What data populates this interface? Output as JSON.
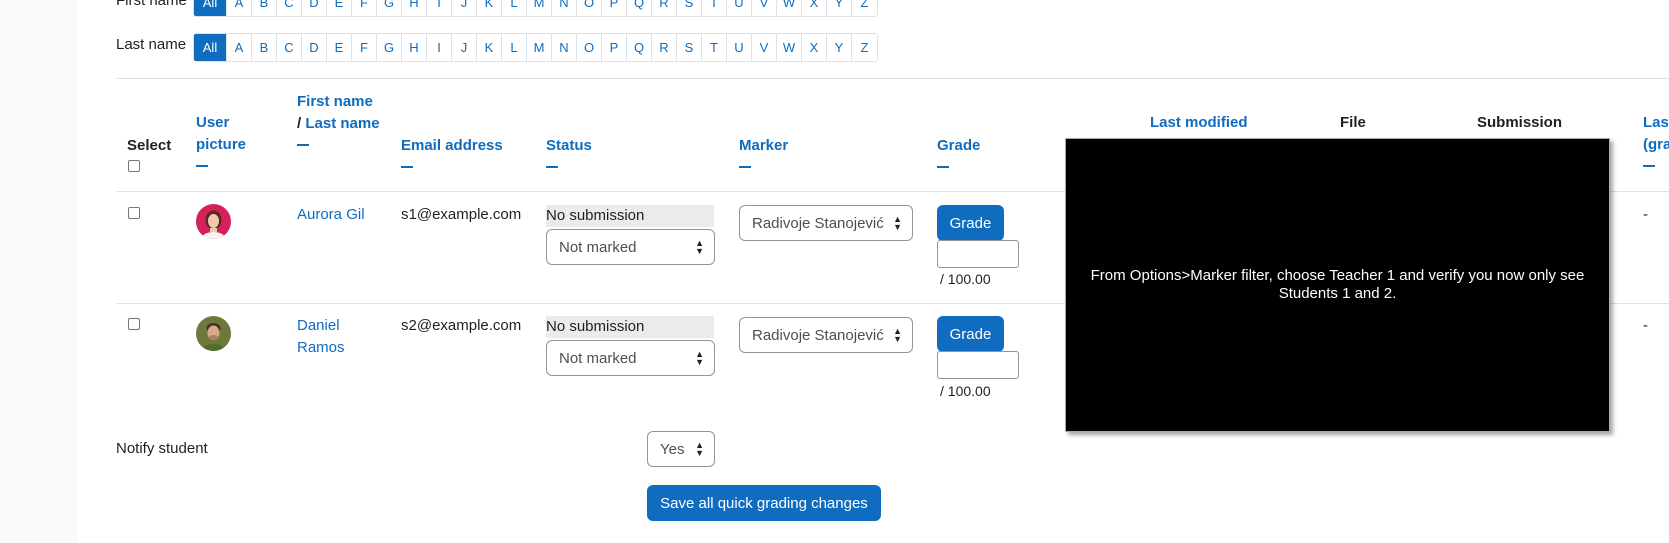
{
  "filters": {
    "first_name_label": "First name",
    "last_name_label": "Last name",
    "letters": [
      "All",
      "A",
      "B",
      "C",
      "D",
      "E",
      "F",
      "G",
      "H",
      "I",
      "J",
      "K",
      "L",
      "M",
      "N",
      "O",
      "P",
      "Q",
      "R",
      "S",
      "T",
      "U",
      "V",
      "W",
      "X",
      "Y",
      "Z"
    ]
  },
  "table": {
    "headers": {
      "select": "Select",
      "user_picture": "User picture",
      "first_name": "First name",
      "slash": "/",
      "last_name": "Last name",
      "email": "Email address",
      "status": "Status",
      "marker": "Marker",
      "grade": "Grade",
      "last_modified": "Last modified",
      "file": "File",
      "submission": "Submission",
      "last_grade_partial_1": "Las",
      "last_grade_partial_2": "(gra"
    },
    "rows": [
      {
        "name_line1": "Aurora Gil",
        "name_line2": "",
        "email": "s1@example.com",
        "status": "No submission",
        "marking": "Not marked",
        "marker": "Radivoje Stanojević",
        "grade_button": "Grade",
        "grade_max": "/ 100.00",
        "last_col": "-"
      },
      {
        "name_line1": "Daniel",
        "name_line2": "Ramos",
        "email": "s2@example.com",
        "status": "No submission",
        "marking": "Not marked",
        "marker": "Radivoje Stanojević",
        "grade_button": "Grade",
        "grade_max": "/ 100.00",
        "last_col": "-"
      }
    ]
  },
  "footer": {
    "notify_label": "Notify student",
    "notify_value": "Yes",
    "save_button": "Save all quick grading changes"
  },
  "overlay": {
    "text": "From Options>Marker filter, choose Teacher 1 and verify you now only see Students 1 and 2."
  },
  "colors": {
    "primary": "#0f6cbf",
    "status_bg": "#ebebeb",
    "overlay_bg": "#000000"
  }
}
